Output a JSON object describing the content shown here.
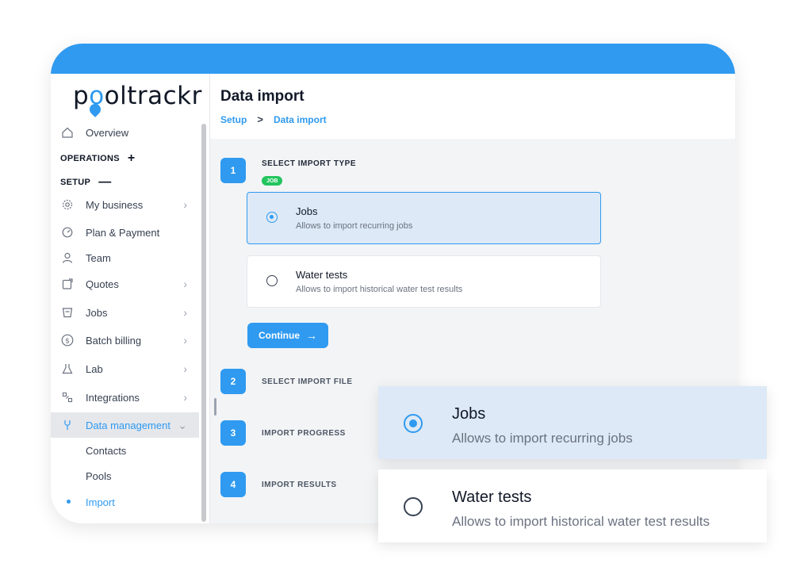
{
  "brand": {
    "logo_text_a": "p",
    "logo_text_pin": "o",
    "logo_text_b": "oltrackr",
    "accent": "#2f9af0"
  },
  "sidebar": {
    "overview": "Overview",
    "operations_label": "OPERATIONS",
    "operations_toggle": "+",
    "setup_label": "SETUP",
    "setup_toggle": "—",
    "items": [
      {
        "label": "My business",
        "icon": "gear-icon"
      },
      {
        "label": "Plan & Payment",
        "icon": "gauge-icon"
      },
      {
        "label": "Team",
        "icon": "user-icon"
      },
      {
        "label": "Quotes",
        "icon": "quote-icon"
      },
      {
        "label": "Jobs",
        "icon": "jobs-icon"
      },
      {
        "label": "Batch billing",
        "icon": "dollar-icon"
      },
      {
        "label": "Lab",
        "icon": "flask-icon"
      },
      {
        "label": "Integrations",
        "icon": "puzzle-icon"
      },
      {
        "label": "Data management",
        "icon": "data-icon"
      }
    ],
    "sub_items": [
      "Contacts",
      "Pools",
      "Import"
    ]
  },
  "header": {
    "title": "Data import",
    "breadcrumb": {
      "root": "Setup",
      "sep": ">",
      "current": "Data import"
    }
  },
  "steps": [
    {
      "num": "1",
      "label": "SELECT IMPORT TYPE"
    },
    {
      "num": "2",
      "label": "SELECT IMPORT FILE"
    },
    {
      "num": "3",
      "label": "IMPORT PROGRESS"
    },
    {
      "num": "4",
      "label": "IMPORT RESULTS"
    }
  ],
  "badge": "JOB",
  "options": [
    {
      "title": "Jobs",
      "desc": "Allows to import recurring jobs",
      "selected": true
    },
    {
      "title": "Water tests",
      "desc": "Allows to import historical water test results",
      "selected": false
    }
  ],
  "continue_label": "Continue",
  "continue_arrow": "→"
}
